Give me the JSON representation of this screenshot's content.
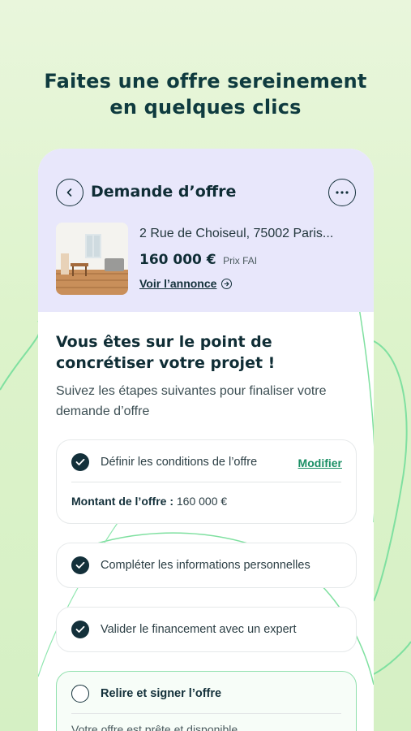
{
  "headline": {
    "line1": "Faites une offre sereinement",
    "line2": "en quelques clics"
  },
  "header": {
    "title": "Demande d’offre",
    "back_icon": "chevron-left-icon",
    "more_icon": "more-horizontal-icon"
  },
  "listing": {
    "address": "2 Rue de Choiseul, 75002 Paris...",
    "price": "160 000 €",
    "price_note": "Prix FAI",
    "link_label": "Voir l’annonce",
    "link_icon": "arrow-right-circle-icon"
  },
  "intro": {
    "title": "Vous êtes sur le point de concrétiser votre projet !",
    "subtitle": "Suivez les étapes suivantes pour finaliser votre demande d’offre"
  },
  "steps": [
    {
      "label": "Définir les conditions de l’offre",
      "done": true,
      "action_label": "Modifier",
      "detail_label": "Montant de l’offre :",
      "detail_value": "160 000 €"
    },
    {
      "label": "Compléter les informations personnelles",
      "done": true
    },
    {
      "label": "Valider le financement avec un expert",
      "done": true
    },
    {
      "label": "Relire et signer l’offre",
      "done": false,
      "partial_text": "Votre offre est prête et disponible"
    }
  ],
  "colors": {
    "dark": "#13303a",
    "accent_green": "#1a8f64",
    "header_bg": "#e8e7fb",
    "page_bg": "#ddf3cb"
  }
}
